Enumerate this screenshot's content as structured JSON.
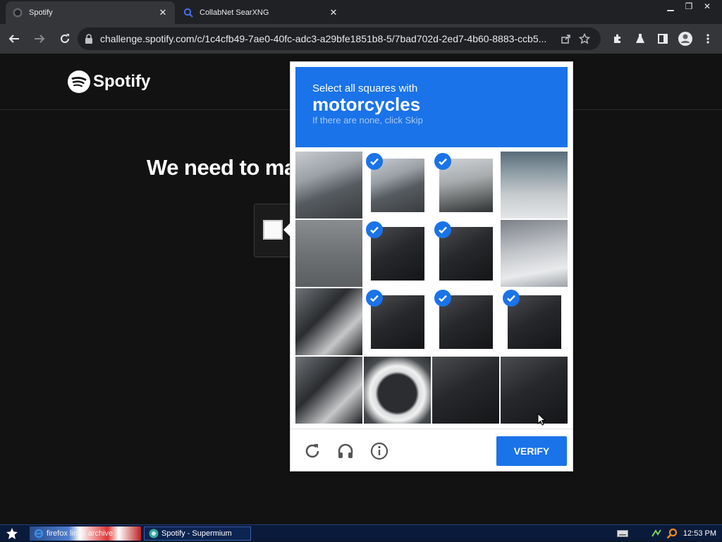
{
  "browser": {
    "tabs": [
      {
        "title": "Spotify"
      },
      {
        "title": "CollabNet SearXNG"
      }
    ],
    "url": "challenge.spotify.com/c/1c4cfb49-7ae0-40fc-adc3-a29bfe1851b8-5/7bad702d-2ed7-4b60-8883-ccb5..."
  },
  "page": {
    "brand": "Spotify",
    "headline": "We need to ma"
  },
  "captcha": {
    "prompt_line1": "Select all squares with",
    "target_word": "motorcycles",
    "hint": "If there are none, click Skip",
    "verify_label": "VERIFY",
    "tiles": [
      {
        "row": 0,
        "col": 0,
        "selected": false,
        "scene": "car"
      },
      {
        "row": 0,
        "col": 1,
        "selected": true,
        "scene": "car"
      },
      {
        "row": 0,
        "col": 2,
        "selected": true,
        "scene": "street"
      },
      {
        "row": 0,
        "col": 3,
        "selected": false,
        "scene": "building"
      },
      {
        "row": 1,
        "col": 0,
        "selected": false,
        "scene": "asphalt"
      },
      {
        "row": 1,
        "col": 1,
        "selected": true,
        "scene": "dark"
      },
      {
        "row": 1,
        "col": 2,
        "selected": true,
        "scene": "dark"
      },
      {
        "row": 1,
        "col": 3,
        "selected": false,
        "scene": "car-silver"
      },
      {
        "row": 2,
        "col": 0,
        "selected": false,
        "scene": "car-dark"
      },
      {
        "row": 2,
        "col": 1,
        "selected": true,
        "scene": "dark"
      },
      {
        "row": 2,
        "col": 2,
        "selected": true,
        "scene": "dark"
      },
      {
        "row": 2,
        "col": 3,
        "selected": true,
        "scene": "dark"
      },
      {
        "row": 3,
        "col": 0,
        "selected": false,
        "scene": "car-dark"
      },
      {
        "row": 3,
        "col": 1,
        "selected": false,
        "scene": "mirror"
      },
      {
        "row": 3,
        "col": 2,
        "selected": false,
        "scene": "dark"
      },
      {
        "row": 3,
        "col": 3,
        "selected": false,
        "scene": "dark"
      }
    ]
  },
  "taskbar": {
    "items": [
      {
        "label": "firefox linke archive"
      },
      {
        "label": "Spotify - Supermium"
      }
    ],
    "clock": "12:53 PM"
  },
  "colors": {
    "accent": "#1a73e8",
    "page_bg": "#121212"
  }
}
